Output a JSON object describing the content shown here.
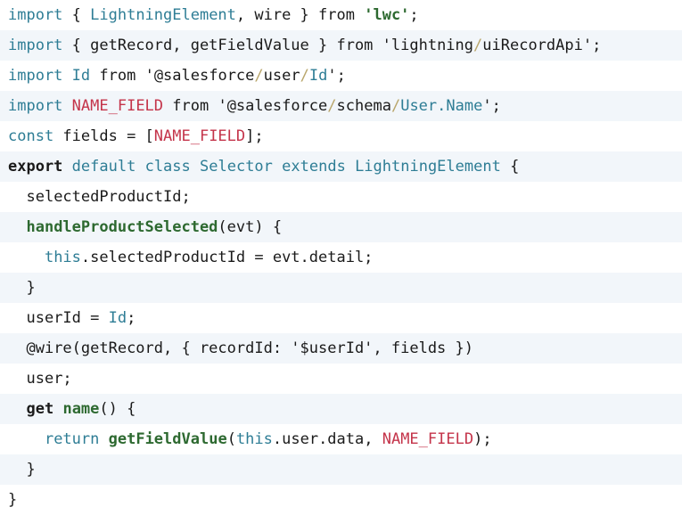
{
  "editor": {
    "language": "javascript",
    "line_count": 17,
    "colors": {
      "background_odd": "#ffffff",
      "background_even": "#f2f6fa",
      "keyword": "#2e7d95",
      "function": "#2d6930",
      "constant": "#c4344a",
      "plain": "#1a1a1a",
      "path_separator": "#b9a66b",
      "string_green": "#2d6930"
    }
  },
  "code": {
    "plain_text": "import { LightningElement, wire } from 'lwc';\nimport { getRecord, getFieldValue } from 'lightning/uiRecordApi';\nimport Id from '@salesforce/user/Id';\nimport NAME_FIELD from '@salesforce/schema/User.Name';\nconst fields = [NAME_FIELD];\nexport default class Selector extends LightningElement {\n  selectedProductId;\n  handleProductSelected(evt) {\n    this.selectedProductId = evt.detail;\n  }\n  userId = Id;\n  @wire(getRecord, { recordId: '$userId', fields })\n  user;\n  get name() {\n    return getFieldValue(this.user.data, NAME_FIELD);\n  }\n}",
    "lines": [
      {
        "number": 1,
        "indent": 0,
        "tokens": [
          {
            "text": "import",
            "kind": "keyword"
          },
          {
            "text": " { ",
            "kind": "plain"
          },
          {
            "text": "LightningElement",
            "kind": "type"
          },
          {
            "text": ", wire } ",
            "kind": "plain"
          },
          {
            "text": "from",
            "kind": "plain"
          },
          {
            "text": " ",
            "kind": "plain"
          },
          {
            "text": "'lwc'",
            "kind": "strgreen"
          },
          {
            "text": ";",
            "kind": "plain"
          }
        ]
      },
      {
        "number": 2,
        "indent": 0,
        "tokens": [
          {
            "text": "import",
            "kind": "keyword"
          },
          {
            "text": " { getRecord, getFieldValue } from ",
            "kind": "plain"
          },
          {
            "text": "'lightning",
            "kind": "string"
          },
          {
            "text": "/",
            "kind": "slash"
          },
          {
            "text": "uiRecordApi';",
            "kind": "string"
          }
        ]
      },
      {
        "number": 3,
        "indent": 0,
        "tokens": [
          {
            "text": "import",
            "kind": "keyword"
          },
          {
            "text": " ",
            "kind": "plain"
          },
          {
            "text": "Id",
            "kind": "type"
          },
          {
            "text": " from ",
            "kind": "plain"
          },
          {
            "text": "'@salesforce",
            "kind": "string"
          },
          {
            "text": "/",
            "kind": "slash"
          },
          {
            "text": "user",
            "kind": "string"
          },
          {
            "text": "/",
            "kind": "slash"
          },
          {
            "text": "Id",
            "kind": "type"
          },
          {
            "text": "';",
            "kind": "string"
          }
        ]
      },
      {
        "number": 4,
        "indent": 0,
        "tokens": [
          {
            "text": "import",
            "kind": "keyword"
          },
          {
            "text": " ",
            "kind": "plain"
          },
          {
            "text": "NAME_FIELD",
            "kind": "const"
          },
          {
            "text": " from ",
            "kind": "plain"
          },
          {
            "text": "'@salesforce",
            "kind": "string"
          },
          {
            "text": "/",
            "kind": "slash"
          },
          {
            "text": "schema",
            "kind": "string"
          },
          {
            "text": "/",
            "kind": "slash"
          },
          {
            "text": "User.Name",
            "kind": "type"
          },
          {
            "text": "';",
            "kind": "string"
          }
        ]
      },
      {
        "number": 5,
        "indent": 0,
        "tokens": [
          {
            "text": "const",
            "kind": "keyword"
          },
          {
            "text": " fields = [",
            "kind": "plain"
          },
          {
            "text": "NAME_FIELD",
            "kind": "const"
          },
          {
            "text": "];",
            "kind": "plain"
          }
        ]
      },
      {
        "number": 6,
        "indent": 0,
        "tokens": [
          {
            "text": "export",
            "kind": "kw-bold"
          },
          {
            "text": " ",
            "kind": "plain"
          },
          {
            "text": "default",
            "kind": "keyword"
          },
          {
            "text": " ",
            "kind": "plain"
          },
          {
            "text": "class",
            "kind": "keyword"
          },
          {
            "text": " ",
            "kind": "plain"
          },
          {
            "text": "Selector",
            "kind": "type"
          },
          {
            "text": " ",
            "kind": "plain"
          },
          {
            "text": "extends",
            "kind": "keyword"
          },
          {
            "text": " ",
            "kind": "plain"
          },
          {
            "text": "LightningElement",
            "kind": "type"
          },
          {
            "text": " {",
            "kind": "plain"
          }
        ]
      },
      {
        "number": 7,
        "indent": 1,
        "tokens": [
          {
            "text": "selectedProductId;",
            "kind": "plain"
          }
        ]
      },
      {
        "number": 8,
        "indent": 1,
        "tokens": [
          {
            "text": "handleProductSelected",
            "kind": "func"
          },
          {
            "text": "(evt) {",
            "kind": "plain"
          }
        ]
      },
      {
        "number": 9,
        "indent": 2,
        "tokens": [
          {
            "text": "this",
            "kind": "this"
          },
          {
            "text": ".selectedProductId = evt.detail;",
            "kind": "plain"
          }
        ]
      },
      {
        "number": 10,
        "indent": 1,
        "tokens": [
          {
            "text": "}",
            "kind": "plain"
          }
        ]
      },
      {
        "number": 11,
        "indent": 1,
        "tokens": [
          {
            "text": "userId = ",
            "kind": "plain"
          },
          {
            "text": "Id",
            "kind": "type"
          },
          {
            "text": ";",
            "kind": "plain"
          }
        ]
      },
      {
        "number": 12,
        "indent": 1,
        "tokens": [
          {
            "text": "@wire(getRecord, { recordId: '$userId', fields })",
            "kind": "plain"
          }
        ]
      },
      {
        "number": 13,
        "indent": 1,
        "tokens": [
          {
            "text": "user;",
            "kind": "plain"
          }
        ]
      },
      {
        "number": 14,
        "indent": 1,
        "tokens": [
          {
            "text": "get",
            "kind": "kw-bold"
          },
          {
            "text": " ",
            "kind": "plain"
          },
          {
            "text": "name",
            "kind": "func"
          },
          {
            "text": "() {",
            "kind": "plain"
          }
        ]
      },
      {
        "number": 15,
        "indent": 2,
        "tokens": [
          {
            "text": "return",
            "kind": "keyword"
          },
          {
            "text": " ",
            "kind": "plain"
          },
          {
            "text": "getFieldValue",
            "kind": "func"
          },
          {
            "text": "(",
            "kind": "plain"
          },
          {
            "text": "this",
            "kind": "this"
          },
          {
            "text": ".user.data, ",
            "kind": "plain"
          },
          {
            "text": "NAME_FIELD",
            "kind": "const"
          },
          {
            "text": ");",
            "kind": "plain"
          }
        ]
      },
      {
        "number": 16,
        "indent": 1,
        "tokens": [
          {
            "text": "}",
            "kind": "plain"
          }
        ]
      },
      {
        "number": 17,
        "indent": 0,
        "tokens": [
          {
            "text": "}",
            "kind": "plain"
          }
        ]
      }
    ]
  }
}
